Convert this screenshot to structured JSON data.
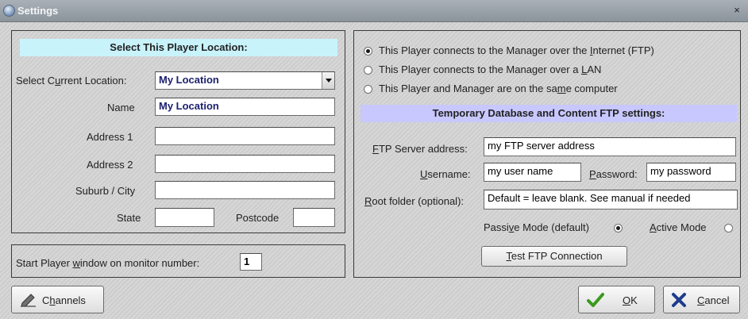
{
  "window": {
    "title": "Settings",
    "close_glyph": "×"
  },
  "location": {
    "header": "Select This Player Location:",
    "header_bg": "#c9f3fb",
    "select_label": "Select Current Location:",
    "select_value": "My Location",
    "name_label": "Name",
    "name_value": "My Location",
    "address1_label": "Address 1",
    "address1_value": "",
    "address2_label": "Address 2",
    "address2_value": "",
    "suburb_label": "Suburb / City",
    "suburb_value": "",
    "state_label": "State",
    "state_value": "",
    "postcode_label": "Postcode",
    "postcode_value": ""
  },
  "monitor": {
    "label": "Start Player window on monitor number:",
    "value": "1"
  },
  "connection": {
    "options": [
      {
        "label": "This Player connects to the Manager over the Internet (FTP)",
        "selected": true
      },
      {
        "label": "This Player connects to the Manager over a LAN",
        "selected": false
      },
      {
        "label": "This Player and Manager are on the same computer",
        "selected": false
      }
    ]
  },
  "ftp": {
    "header": "Temporary Database and Content FTP settings:",
    "header_bg": "#c8c8ff",
    "server_label": "FTP Server address:",
    "server_value": "my FTP server address",
    "username_label": "Username:",
    "username_value": "my user name",
    "password_label": "Password:",
    "password_value": "my password",
    "root_label": "Root folder (optional):",
    "root_value": "Default = leave blank. See manual if needed",
    "passive_label": "Passive Mode (default)",
    "passive_selected": true,
    "active_label": "Active Mode",
    "active_selected": false,
    "test_button": "Test FTP Connection"
  },
  "footer": {
    "channels_button": "Channels",
    "channels_icon": "pen-icon",
    "ok_button": "OK",
    "ok_icon": "checkmark-icon",
    "ok_color": "#3a9a1e",
    "cancel_button": "Cancel",
    "cancel_icon": "x-icon",
    "cancel_color": "#1f3c8c"
  }
}
